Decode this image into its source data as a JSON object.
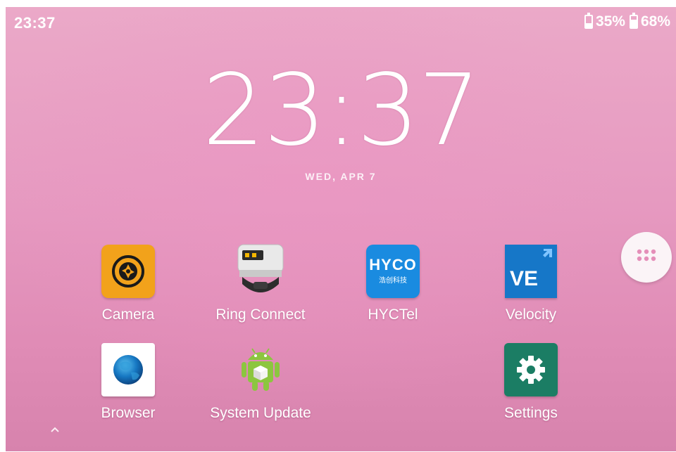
{
  "status_bar": {
    "time": "23:37",
    "batteries": [
      {
        "percent_label": "35%",
        "level": 0.35
      },
      {
        "percent_label": "68%",
        "level": 0.68
      }
    ]
  },
  "clock_widget": {
    "time": "23:37",
    "date": "WED, APR 7"
  },
  "apps": [
    {
      "label": "Camera",
      "icon": "camera-icon"
    },
    {
      "label": "Ring Connect",
      "icon": "ring-scanner-icon"
    },
    {
      "label": "HYCTel",
      "icon": "hyco-logo-icon",
      "icon_text_top": "HYCO",
      "icon_text_bottom": "浩创科技"
    },
    {
      "label": "Velocity",
      "icon": "velocity-icon",
      "icon_text": "VE"
    },
    {
      "label": "Browser",
      "icon": "globe-icon"
    },
    {
      "label": "System Update",
      "icon": "android-update-icon"
    },
    {
      "label": "Settings",
      "icon": "gear-icon"
    }
  ],
  "app_drawer": {
    "icon": "app-drawer-icon"
  },
  "nav": {
    "icon": "chevron-up-icon"
  },
  "colors": {
    "wallpaper_top": "#eba9c8",
    "wallpaper_bottom": "#d783ad",
    "camera": "#f2a21b",
    "hyco": "#1a8be0",
    "velocity": "#1677c8",
    "settings": "#1b7d64",
    "android_green": "#8cc63f"
  }
}
